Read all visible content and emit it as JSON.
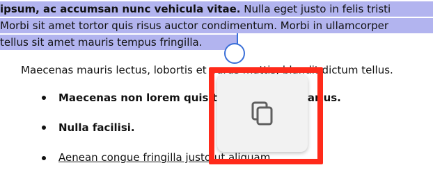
{
  "selection": {
    "line1_bold": "ipsum, ac accumsan nunc vehicula vitae.",
    "line1_rest": " Nulla eget justo in felis tristi",
    "line2": "Morbi sit amet tortor quis risus auctor condimentum. Morbi in ullamcorper",
    "line3": "tellus sit amet mauris tempus fringilla."
  },
  "paragraph": "Maecenas mauris lectus, lobortis et purus mattis, blandit dictum tellus.",
  "list": {
    "item1": "Maecenas non lorem quis tellus placerat varius.",
    "item2": "Nulla facilisi.",
    "item3": "Aenean congue fringilla justo ut aliquam."
  },
  "popup": {
    "icon": "copy-icon",
    "highlight_color": "#ff2a1a"
  },
  "colors": {
    "selection": "#b2b4ef",
    "handle": "#3a6fd8"
  }
}
